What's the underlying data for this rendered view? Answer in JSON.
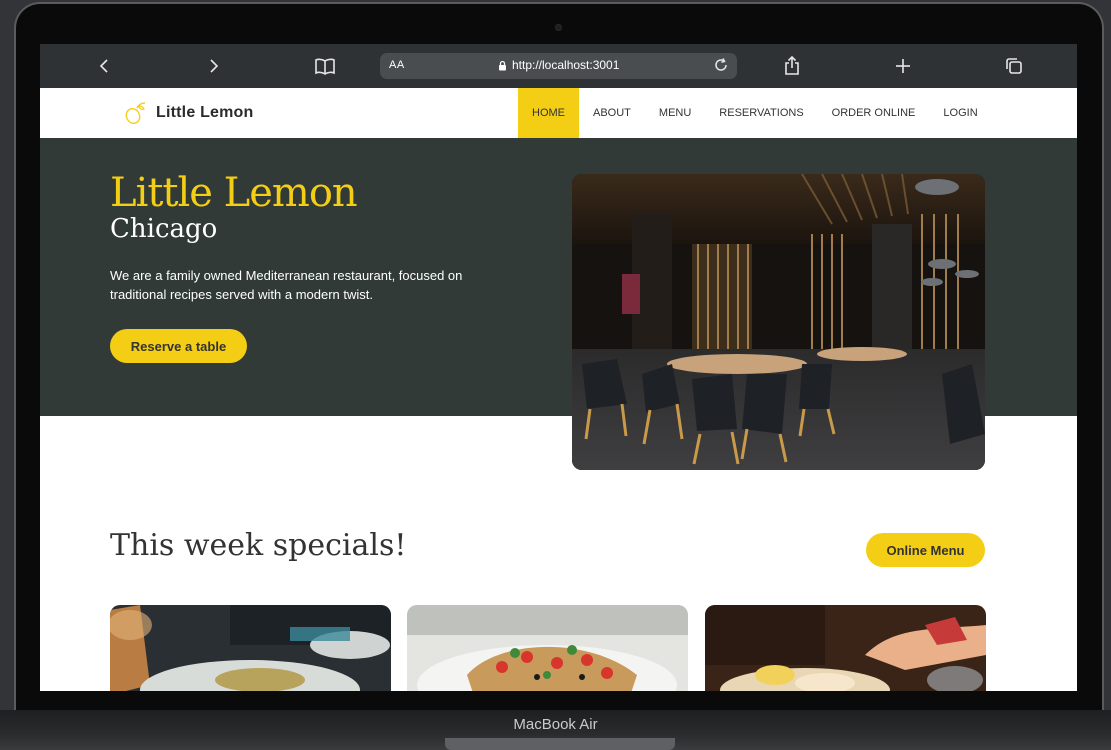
{
  "device": {
    "label": "MacBook Air"
  },
  "browser": {
    "address_prefix": "AA",
    "url": "http://localhost:3001",
    "icons": [
      "back-icon",
      "forward-icon",
      "book-icon",
      "lock-icon",
      "reload-icon",
      "share-icon",
      "plus-icon",
      "tabs-icon"
    ]
  },
  "site": {
    "logo_text": "Little Lemon",
    "nav": [
      {
        "label": "HOME",
        "active": true
      },
      {
        "label": "ABOUT",
        "active": false
      },
      {
        "label": "MENU",
        "active": false
      },
      {
        "label": "RESERVATIONS",
        "active": false
      },
      {
        "label": "ORDER ONLINE",
        "active": false
      },
      {
        "label": "LOGIN",
        "active": false
      }
    ],
    "hero": {
      "title": "Little Lemon",
      "subtitle": "Chicago",
      "description": "We are a family owned Mediterranean restaurant, focused on traditional recipes served with a modern twist.",
      "cta_label": "Reserve a table"
    },
    "specials": {
      "title": "This week specials!",
      "button_label": "Online Menu"
    }
  },
  "colors": {
    "accent": "#f4ce14",
    "hero_bg": "#313a37",
    "browser_toolbar": "#2f3234"
  }
}
